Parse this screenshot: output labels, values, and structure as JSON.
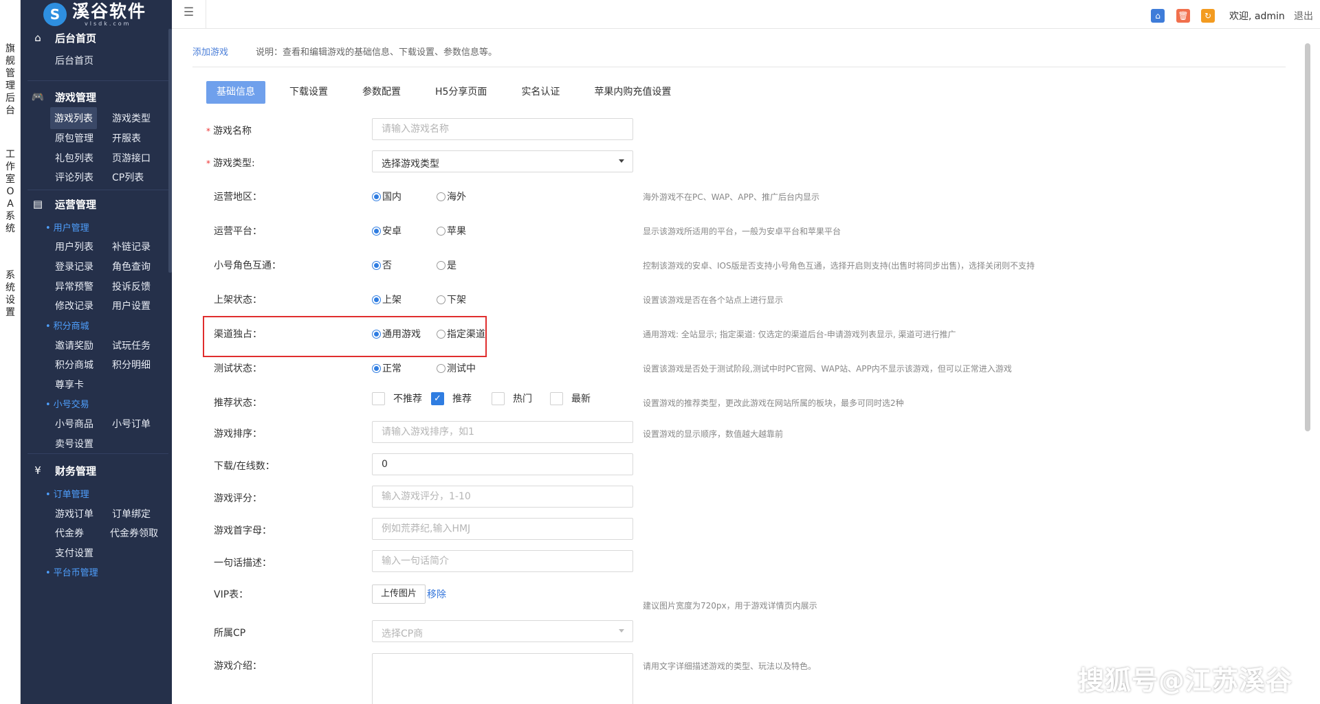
{
  "vertical_strip": [
    "旗舰管理后台",
    "工作室OA系统",
    "系统设置"
  ],
  "logo": {
    "name": "溪谷软件",
    "sub": "vlsdk.com",
    "mark": "S"
  },
  "sidebar": {
    "home": {
      "title": "后台首页",
      "items": [
        "后台首页"
      ]
    },
    "game": {
      "title": "游戏管理",
      "items": [
        "游戏列表",
        "游戏类型",
        "原包管理",
        "开服表",
        "礼包列表",
        "页游接口",
        "评论列表",
        "CP列表"
      ]
    },
    "ops": {
      "title": "运营管理",
      "sub_user": "用户管理",
      "user_items": [
        "用户列表",
        "补链记录",
        "登录记录",
        "角色查询",
        "异常预警",
        "投诉反馈",
        "修改记录",
        "用户设置"
      ],
      "sub_points": "积分商城",
      "points_items": [
        "邀请奖励",
        "试玩任务",
        "积分商城",
        "积分明细",
        "尊享卡"
      ],
      "sub_trade": "小号交易",
      "trade_items": [
        "小号商品",
        "小号订单",
        "卖号设置"
      ]
    },
    "finance": {
      "title": "财务管理",
      "sub_order": "订单管理",
      "order_items": [
        "游戏订单",
        "订单绑定",
        "代金券",
        "代金券领取",
        "支付设置"
      ],
      "sub_coin": "平台币管理"
    }
  },
  "topbar": {
    "welcome": "欢迎, admin",
    "logout": "退出"
  },
  "breadcrumb": {
    "current": "添加游戏",
    "desc": "说明：查看和编辑游戏的基础信息、下载设置、参数信息等。"
  },
  "tabs": [
    "基础信息",
    "下载设置",
    "参数配置",
    "H5分享页面",
    "实名认证",
    "苹果内购充值设置"
  ],
  "form": {
    "name": {
      "label": "游戏名称",
      "placeholder": "请输入游戏名称"
    },
    "type": {
      "label": "游戏类型:",
      "value": "选择游戏类型"
    },
    "region": {
      "label": "运营地区：",
      "opt1": "国内",
      "opt2": "海外",
      "hint": "海外游戏不在PC、WAP、APP、推广后台内显示"
    },
    "platform": {
      "label": "运营平台：",
      "opt1": "安卓",
      "opt2": "苹果",
      "hint": "显示该游戏所适用的平台，一般为安卓平台和苹果平台"
    },
    "account_sync": {
      "label": "小号角色互通：",
      "opt1": "否",
      "opt2": "是",
      "hint": "控制该游戏的安卓、IOS版是否支持小号角色互通，选择开启则支持(出售时将同步出售)，选择关闭则不支持"
    },
    "shelf": {
      "label": "上架状态：",
      "opt1": "上架",
      "opt2": "下架",
      "hint": "设置该游戏是否在各个站点上进行显示"
    },
    "channel": {
      "label": "渠道独占：",
      "opt1": "通用游戏",
      "opt2": "指定渠道",
      "hint": "通用游戏: 全站显示; 指定渠道: 仅选定的渠道后台-申请游戏列表显示, 渠道可进行推广"
    },
    "test": {
      "label": "测试状态：",
      "opt1": "正常",
      "opt2": "测试中",
      "hint": "设置该游戏是否处于测试阶段,测试中时PC官网、WAP站、APP内不显示该游戏，但可以正常进入游戏"
    },
    "recommend": {
      "label": "推荐状态：",
      "opts": [
        "不推荐",
        "推荐",
        "热门",
        "最新"
      ],
      "hint": "设置游戏的推荐类型，更改此游戏在网站所属的板块，最多可同时选2种"
    },
    "sort": {
      "label": "游戏排序：",
      "placeholder": "请输入游戏排序，如1",
      "hint": "设置游戏的显示顺序，数值越大越靠前"
    },
    "downloads": {
      "label": "下载/在线数：",
      "value": "0"
    },
    "score": {
      "label": "游戏评分：",
      "placeholder": "输入游戏评分，1-10"
    },
    "initial": {
      "label": "游戏首字母：",
      "placeholder": "例如荒莽纪,输入HMJ"
    },
    "brief": {
      "label": "一句话描述：",
      "placeholder": "输入一句话简介"
    },
    "vip": {
      "label": "VIP表：",
      "upload": "上传图片",
      "remove": "移除",
      "hint": "建议图片宽度为720px，用于游戏详情页内展示"
    },
    "cp": {
      "label": "所属CP",
      "value": "选择CP商"
    },
    "intro": {
      "label": "游戏介绍：",
      "hint": "请用文字详细描述游戏的类型、玩法以及特色。"
    }
  },
  "watermark": "搜狐号@江苏溪谷",
  "colors": {
    "sidebar_bg": "#25304a",
    "accent": "#2f7de1",
    "tab_active": "#6fa0ec",
    "highlight": "#e02d2d"
  }
}
